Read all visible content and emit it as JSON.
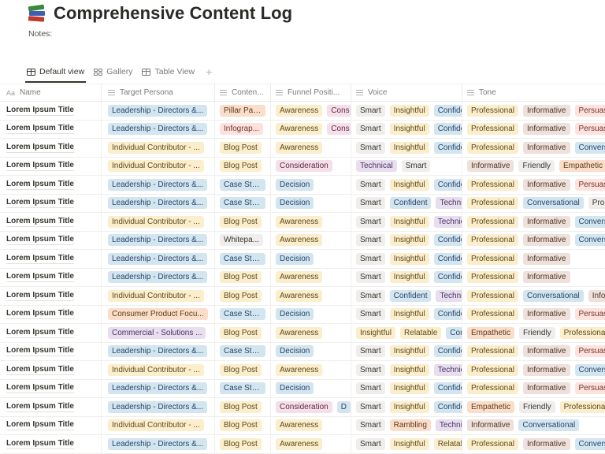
{
  "page": {
    "title": "Comprehensive Content Log",
    "icon": "books-emoji",
    "notes_label": "Notes:"
  },
  "tabs": [
    {
      "label": "Default view",
      "icon": "table-icon",
      "active": true
    },
    {
      "label": "Gallery",
      "icon": "gallery-icon",
      "active": false
    },
    {
      "label": "Table View",
      "icon": "table-icon",
      "active": false
    }
  ],
  "add_view_label": "+",
  "columns": [
    {
      "key": "name",
      "label": "Name",
      "icon": "Aa"
    },
    {
      "key": "persona",
      "label": "Target Persona",
      "icon": "list-icon"
    },
    {
      "key": "content",
      "label": "Conten...",
      "icon": "list-icon"
    },
    {
      "key": "funnel",
      "label": "Funnel Positi...",
      "icon": "list-icon"
    },
    {
      "key": "voice",
      "label": "Voice",
      "icon": "list-icon"
    },
    {
      "key": "tone",
      "label": "Tone",
      "icon": "list-icon"
    }
  ],
  "colors": {
    "blue": "#d3e5ef",
    "yellow": "#fbeecc",
    "orange": "#fadec9",
    "red": "#ffe2dd",
    "pink": "#f5e0e9",
    "purple": "#e8deee",
    "gray": "#efeeec",
    "brown": "#eee0da"
  },
  "rows": [
    {
      "name": "Lorem Ipsum Title",
      "persona": [
        {
          "t": "Leadership - Directors &...",
          "c": "blue"
        }
      ],
      "content": [
        {
          "t": "Pillar Page",
          "c": "orange"
        }
      ],
      "funnel": [
        {
          "t": "Awareness",
          "c": "yellow"
        },
        {
          "t": "Cons",
          "c": "pink"
        }
      ],
      "voice": [
        {
          "t": "Smart",
          "c": "gray"
        },
        {
          "t": "Insightful",
          "c": "yellow"
        },
        {
          "t": "Confide",
          "c": "blue"
        }
      ],
      "tone": [
        {
          "t": "Professional",
          "c": "yellow"
        },
        {
          "t": "Informative",
          "c": "brown"
        },
        {
          "t": "Persuas",
          "c": "red"
        }
      ]
    },
    {
      "name": "Lorem Ipsum Title",
      "persona": [
        {
          "t": "Leadership - Directors &...",
          "c": "blue"
        }
      ],
      "content": [
        {
          "t": "Infograp...",
          "c": "red"
        }
      ],
      "funnel": [
        {
          "t": "Awareness",
          "c": "yellow"
        },
        {
          "t": "Cons",
          "c": "pink"
        }
      ],
      "voice": [
        {
          "t": "Smart",
          "c": "gray"
        },
        {
          "t": "Insightful",
          "c": "yellow"
        },
        {
          "t": "Confide",
          "c": "blue"
        }
      ],
      "tone": [
        {
          "t": "Professional",
          "c": "yellow"
        },
        {
          "t": "Informative",
          "c": "brown"
        },
        {
          "t": "Persuas",
          "c": "red"
        }
      ]
    },
    {
      "name": "Lorem Ipsum Title",
      "persona": [
        {
          "t": "Individual Contributor - ...",
          "c": "yellow"
        }
      ],
      "content": [
        {
          "t": "Blog Post",
          "c": "yellow"
        }
      ],
      "funnel": [
        {
          "t": "Awareness",
          "c": "yellow"
        }
      ],
      "voice": [
        {
          "t": "Smart",
          "c": "gray"
        },
        {
          "t": "Insightful",
          "c": "yellow"
        },
        {
          "t": "Confide",
          "c": "blue"
        }
      ],
      "tone": [
        {
          "t": "Professional",
          "c": "yellow"
        },
        {
          "t": "Informative",
          "c": "brown"
        },
        {
          "t": "Convers",
          "c": "blue"
        }
      ]
    },
    {
      "name": "Lorem Ipsum Title",
      "persona": [
        {
          "t": "Individual Contributor - ...",
          "c": "yellow"
        }
      ],
      "content": [
        {
          "t": "Blog Post",
          "c": "yellow"
        }
      ],
      "funnel": [
        {
          "t": "Consideration",
          "c": "pink"
        }
      ],
      "voice": [
        {
          "t": "Technical",
          "c": "purple"
        },
        {
          "t": "Smart",
          "c": "gray"
        }
      ],
      "tone": [
        {
          "t": "Informative",
          "c": "brown"
        },
        {
          "t": "Friendly",
          "c": "gray"
        },
        {
          "t": "Empathetic",
          "c": "orange"
        }
      ]
    },
    {
      "name": "Lorem Ipsum Title",
      "persona": [
        {
          "t": "Leadership - Directors &...",
          "c": "blue"
        }
      ],
      "content": [
        {
          "t": "Case Stu...",
          "c": "blue"
        }
      ],
      "funnel": [
        {
          "t": "Decision",
          "c": "blue"
        }
      ],
      "voice": [
        {
          "t": "Smart",
          "c": "gray"
        },
        {
          "t": "Insightful",
          "c": "yellow"
        },
        {
          "t": "Confide",
          "c": "blue"
        }
      ],
      "tone": [
        {
          "t": "Professional",
          "c": "yellow"
        },
        {
          "t": "Informative",
          "c": "brown"
        },
        {
          "t": "Persuas",
          "c": "red"
        }
      ]
    },
    {
      "name": "Lorem Ipsum Title",
      "persona": [
        {
          "t": "Leadership - Directors &...",
          "c": "blue"
        }
      ],
      "content": [
        {
          "t": "Case Stu...",
          "c": "blue"
        }
      ],
      "funnel": [
        {
          "t": "Decision",
          "c": "blue"
        }
      ],
      "voice": [
        {
          "t": "Smart",
          "c": "gray"
        },
        {
          "t": "Confident",
          "c": "blue"
        },
        {
          "t": "Techni",
          "c": "purple"
        }
      ],
      "tone": [
        {
          "t": "Professional",
          "c": "yellow"
        },
        {
          "t": "Conversational",
          "c": "blue"
        },
        {
          "t": "Pro",
          "c": "gray"
        }
      ]
    },
    {
      "name": "Lorem Ipsum Title",
      "persona": [
        {
          "t": "Individual Contributor - ...",
          "c": "yellow"
        }
      ],
      "content": [
        {
          "t": "Blog Post",
          "c": "yellow"
        }
      ],
      "funnel": [
        {
          "t": "Awareness",
          "c": "yellow"
        }
      ],
      "voice": [
        {
          "t": "Smart",
          "c": "gray"
        },
        {
          "t": "Insightful",
          "c": "yellow"
        },
        {
          "t": "Technic",
          "c": "purple"
        }
      ],
      "tone": [
        {
          "t": "Professional",
          "c": "yellow"
        },
        {
          "t": "Informative",
          "c": "brown"
        },
        {
          "t": "Convers",
          "c": "blue"
        }
      ]
    },
    {
      "name": "Lorem Ipsum Title",
      "persona": [
        {
          "t": "Leadership - Directors &...",
          "c": "blue"
        }
      ],
      "content": [
        {
          "t": "Whitepa...",
          "c": "gray"
        }
      ],
      "funnel": [
        {
          "t": "Awareness",
          "c": "yellow"
        }
      ],
      "voice": [
        {
          "t": "Smart",
          "c": "gray"
        },
        {
          "t": "Insightful",
          "c": "yellow"
        },
        {
          "t": "Confide",
          "c": "blue"
        }
      ],
      "tone": [
        {
          "t": "Professional",
          "c": "yellow"
        },
        {
          "t": "Informative",
          "c": "brown"
        },
        {
          "t": "Convers",
          "c": "blue"
        }
      ]
    },
    {
      "name": "Lorem Ipsum Title",
      "persona": [
        {
          "t": "Leadership - Directors &...",
          "c": "blue"
        }
      ],
      "content": [
        {
          "t": "Case Stu...",
          "c": "blue"
        }
      ],
      "funnel": [
        {
          "t": "Decision",
          "c": "blue"
        }
      ],
      "voice": [
        {
          "t": "Smart",
          "c": "gray"
        },
        {
          "t": "Insightful",
          "c": "yellow"
        },
        {
          "t": "Confide",
          "c": "blue"
        }
      ],
      "tone": [
        {
          "t": "Professional",
          "c": "yellow"
        },
        {
          "t": "Informative",
          "c": "brown"
        }
      ]
    },
    {
      "name": "Lorem Ipsum Title",
      "persona": [
        {
          "t": "Leadership - Directors &...",
          "c": "blue"
        }
      ],
      "content": [
        {
          "t": "Blog Post",
          "c": "yellow"
        }
      ],
      "funnel": [
        {
          "t": "Awareness",
          "c": "yellow"
        }
      ],
      "voice": [
        {
          "t": "Smart",
          "c": "gray"
        },
        {
          "t": "Insightful",
          "c": "yellow"
        },
        {
          "t": "Confide",
          "c": "blue"
        }
      ],
      "tone": [
        {
          "t": "Professional",
          "c": "yellow"
        },
        {
          "t": "Informative",
          "c": "brown"
        }
      ]
    },
    {
      "name": "Lorem Ipsum Title",
      "persona": [
        {
          "t": "Individual Contributor - ...",
          "c": "yellow"
        }
      ],
      "content": [
        {
          "t": "Blog Post",
          "c": "yellow"
        }
      ],
      "funnel": [
        {
          "t": "Awareness",
          "c": "yellow"
        }
      ],
      "voice": [
        {
          "t": "Smart",
          "c": "gray"
        },
        {
          "t": "Confident",
          "c": "blue"
        },
        {
          "t": "Techni",
          "c": "purple"
        }
      ],
      "tone": [
        {
          "t": "Professional",
          "c": "yellow"
        },
        {
          "t": "Conversational",
          "c": "blue"
        },
        {
          "t": "Info",
          "c": "brown"
        }
      ]
    },
    {
      "name": "Lorem Ipsum Title",
      "persona": [
        {
          "t": "Consumer Product Focu...",
          "c": "orange"
        }
      ],
      "content": [
        {
          "t": "Case Stu...",
          "c": "blue"
        }
      ],
      "funnel": [
        {
          "t": "Decision",
          "c": "blue"
        }
      ],
      "voice": [
        {
          "t": "Smart",
          "c": "gray"
        },
        {
          "t": "Insightful",
          "c": "yellow"
        },
        {
          "t": "Confide",
          "c": "blue"
        }
      ],
      "tone": [
        {
          "t": "Professional",
          "c": "yellow"
        },
        {
          "t": "Informative",
          "c": "brown"
        },
        {
          "t": "Persuas",
          "c": "red"
        }
      ]
    },
    {
      "name": "Lorem Ipsum Title",
      "persona": [
        {
          "t": "Commercial - Solutions ...",
          "c": "purple"
        }
      ],
      "content": [
        {
          "t": "Blog Post",
          "c": "yellow"
        }
      ],
      "funnel": [
        {
          "t": "Awareness",
          "c": "yellow"
        }
      ],
      "voice": [
        {
          "t": "Insightful",
          "c": "yellow"
        },
        {
          "t": "Relatable",
          "c": "yellow"
        },
        {
          "t": "Con",
          "c": "blue"
        }
      ],
      "tone": [
        {
          "t": "Empathetic",
          "c": "orange"
        },
        {
          "t": "Friendly",
          "c": "gray"
        },
        {
          "t": "Professiona",
          "c": "yellow"
        }
      ]
    },
    {
      "name": "Lorem Ipsum Title",
      "persona": [
        {
          "t": "Leadership - Directors &...",
          "c": "blue"
        }
      ],
      "content": [
        {
          "t": "Case Stu...",
          "c": "blue"
        }
      ],
      "funnel": [
        {
          "t": "Decision",
          "c": "blue"
        }
      ],
      "voice": [
        {
          "t": "Smart",
          "c": "gray"
        },
        {
          "t": "Insightful",
          "c": "yellow"
        },
        {
          "t": "Confide",
          "c": "blue"
        }
      ],
      "tone": [
        {
          "t": "Professional",
          "c": "yellow"
        },
        {
          "t": "Informative",
          "c": "brown"
        },
        {
          "t": "Persuas",
          "c": "red"
        }
      ]
    },
    {
      "name": "Lorem Ipsum Title",
      "persona": [
        {
          "t": "Individual Contributor - ...",
          "c": "yellow"
        }
      ],
      "content": [
        {
          "t": "Blog Post",
          "c": "yellow"
        }
      ],
      "funnel": [
        {
          "t": "Awareness",
          "c": "yellow"
        }
      ],
      "voice": [
        {
          "t": "Smart",
          "c": "gray"
        },
        {
          "t": "Insightful",
          "c": "yellow"
        },
        {
          "t": "Technic",
          "c": "purple"
        }
      ],
      "tone": [
        {
          "t": "Professional",
          "c": "yellow"
        },
        {
          "t": "Informative",
          "c": "brown"
        },
        {
          "t": "Convers",
          "c": "blue"
        }
      ]
    },
    {
      "name": "Lorem Ipsum Title",
      "persona": [
        {
          "t": "Leadership - Directors &...",
          "c": "blue"
        }
      ],
      "content": [
        {
          "t": "Case Stu...",
          "c": "blue"
        }
      ],
      "funnel": [
        {
          "t": "Decision",
          "c": "blue"
        }
      ],
      "voice": [
        {
          "t": "Smart",
          "c": "gray"
        },
        {
          "t": "Insightful",
          "c": "yellow"
        },
        {
          "t": "Confide",
          "c": "blue"
        }
      ],
      "tone": [
        {
          "t": "Professional",
          "c": "yellow"
        },
        {
          "t": "Informative",
          "c": "brown"
        },
        {
          "t": "Persuas",
          "c": "red"
        }
      ]
    },
    {
      "name": "Lorem Ipsum Title",
      "persona": [
        {
          "t": "Leadership - Directors &...",
          "c": "blue"
        }
      ],
      "content": [
        {
          "t": "Blog Post",
          "c": "yellow"
        }
      ],
      "funnel": [
        {
          "t": "Consideration",
          "c": "pink"
        },
        {
          "t": "D",
          "c": "blue"
        }
      ],
      "voice": [
        {
          "t": "Smart",
          "c": "gray"
        },
        {
          "t": "Insightful",
          "c": "yellow"
        },
        {
          "t": "Confide",
          "c": "blue"
        }
      ],
      "tone": [
        {
          "t": "Empathetic",
          "c": "orange"
        },
        {
          "t": "Friendly",
          "c": "gray"
        },
        {
          "t": "Professiona",
          "c": "yellow"
        }
      ]
    },
    {
      "name": "Lorem Ipsum Title",
      "persona": [
        {
          "t": "Individual Contributor - ...",
          "c": "yellow"
        }
      ],
      "content": [
        {
          "t": "Blog Post",
          "c": "yellow"
        }
      ],
      "funnel": [
        {
          "t": "Awareness",
          "c": "yellow"
        }
      ],
      "voice": [
        {
          "t": "Smart",
          "c": "gray"
        },
        {
          "t": "Rambling",
          "c": "orange"
        },
        {
          "t": "Technic",
          "c": "purple"
        }
      ],
      "tone": [
        {
          "t": "Informative",
          "c": "brown"
        },
        {
          "t": "Conversational",
          "c": "blue"
        }
      ]
    },
    {
      "name": "Lorem Ipsum Title",
      "persona": [
        {
          "t": "Leadership - Directors &...",
          "c": "blue"
        }
      ],
      "content": [
        {
          "t": "Blog Post",
          "c": "yellow"
        }
      ],
      "funnel": [
        {
          "t": "Awareness",
          "c": "yellow"
        }
      ],
      "voice": [
        {
          "t": "Smart",
          "c": "gray"
        },
        {
          "t": "Insightful",
          "c": "yellow"
        },
        {
          "t": "Relatab",
          "c": "yellow"
        }
      ],
      "tone": [
        {
          "t": "Professional",
          "c": "yellow"
        },
        {
          "t": "Informative",
          "c": "brown"
        },
        {
          "t": "Convers",
          "c": "blue"
        }
      ]
    }
  ]
}
